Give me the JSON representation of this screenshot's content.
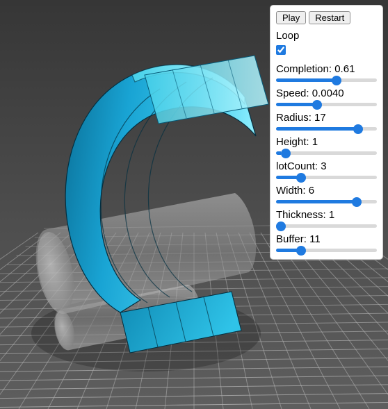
{
  "controls": {
    "play_label": "Play",
    "restart_label": "Restart",
    "loop": {
      "label": "Loop",
      "checked": true
    },
    "completion": {
      "label": "Completion",
      "value": 0.61,
      "min": 0,
      "max": 1,
      "step": 0.01,
      "display": "0.61"
    },
    "speed": {
      "label": "Speed",
      "value": 0.004,
      "min": 0,
      "max": 0.01,
      "step": 0.0001,
      "display": "0.0040"
    },
    "radius": {
      "label": "Radius",
      "value": 17,
      "min": 0,
      "max": 20,
      "step": 1,
      "display": "17"
    },
    "height": {
      "label": "Height",
      "value": 1,
      "min": 0,
      "max": 20,
      "step": 1,
      "display": "1"
    },
    "lotCount": {
      "label": "lotCount",
      "value": 3,
      "min": 1,
      "max": 10,
      "step": 1,
      "display": "3"
    },
    "width": {
      "label": "Width",
      "value": 6,
      "min": 1,
      "max": 7,
      "step": 1,
      "display": "6"
    },
    "thickness": {
      "label": "Thickness",
      "value": 1,
      "min": 1,
      "max": 20,
      "step": 1,
      "display": "1"
    },
    "buffer": {
      "label": "Buffer",
      "value": 11,
      "min": 0,
      "max": 50,
      "step": 1,
      "display": "11"
    }
  },
  "scene": {
    "background_top": "#3a3a3a",
    "background_bottom": "#5a5a5a",
    "grid_color": "#cccccc",
    "object_color": "#18a8d8",
    "object_highlight": "#7ce6f3",
    "cylinder_color": "#9d9d9d"
  }
}
